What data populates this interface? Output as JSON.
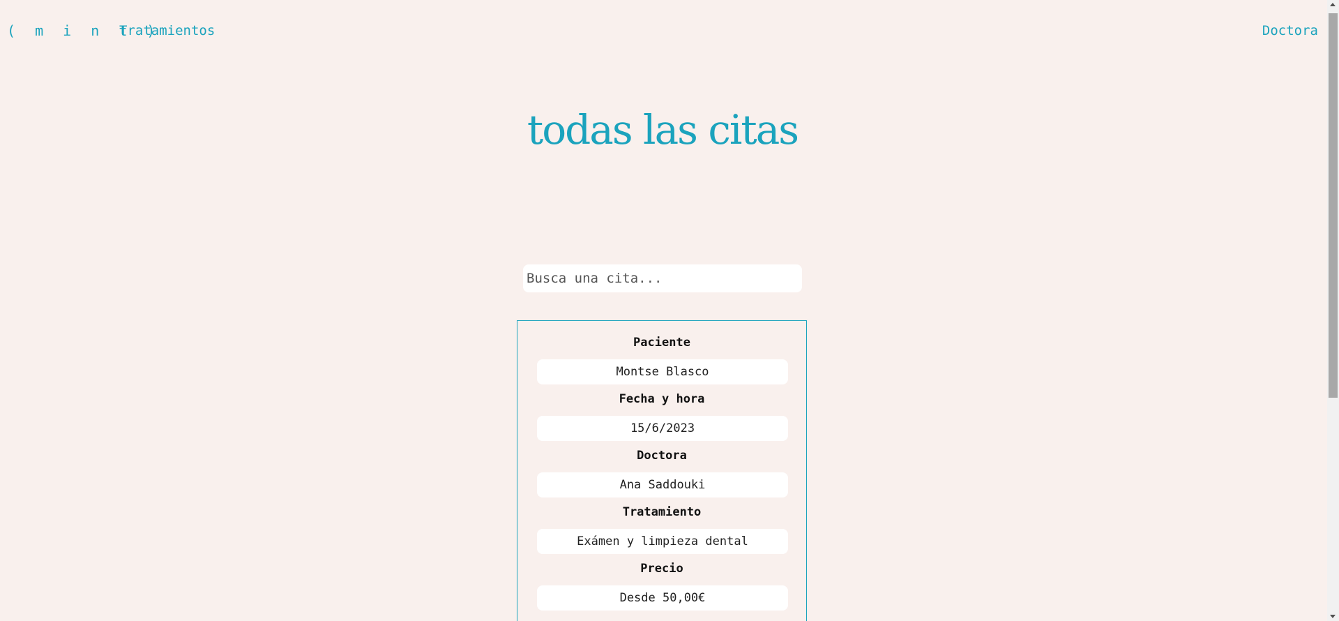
{
  "nav": {
    "brand": "( m i n t )",
    "treatments": "Tratamientos",
    "doctor": "Doctora"
  },
  "page": {
    "title": "todas las citas"
  },
  "search": {
    "placeholder": "Busca una cita...",
    "value": ""
  },
  "appointment": {
    "fields": [
      {
        "label": "Paciente",
        "value": "Montse Blasco"
      },
      {
        "label": "Fecha y hora",
        "value": "15/6/2023"
      },
      {
        "label": "Doctora",
        "value": "Ana Saddouki"
      },
      {
        "label": "Tratamiento",
        "value": "Exámen y limpieza dental"
      },
      {
        "label": "Precio",
        "value": "Desde 50,00€"
      }
    ]
  },
  "colors": {
    "accent": "#1ba3bd",
    "background": "#f9f0ed"
  },
  "scrollbar": {
    "visible_fraction": 0.62,
    "position": 0
  }
}
